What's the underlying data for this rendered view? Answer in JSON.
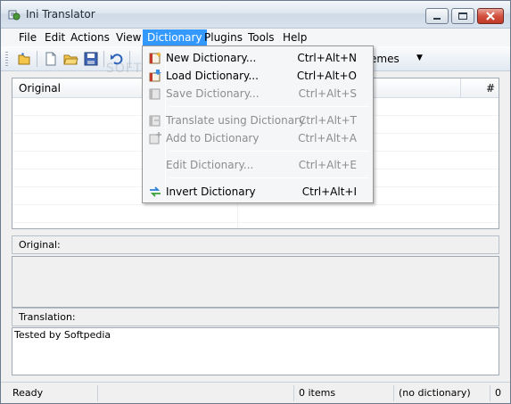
{
  "window": {
    "title": "Ini Translator"
  },
  "menubar": {
    "items": [
      "File",
      "Edit",
      "Actions",
      "View",
      "Dictionary",
      "Plugins",
      "Tools",
      "Help"
    ]
  },
  "toolbar": {
    "themes_label": "emes",
    "themes_arrow": "▼"
  },
  "listview": {
    "columns": [
      "Original",
      "#"
    ]
  },
  "panels": {
    "original_label": "Original:",
    "translation_label": "Translation:",
    "translation_text": "Tested by Softpedia"
  },
  "statusbar": {
    "status": "Ready",
    "items_count": "0 items",
    "dictionary": "(no dictionary)",
    "extra": "0"
  },
  "dictionary_menu": {
    "items": [
      {
        "label": "New Dictionary...",
        "shortcut": "Ctrl+Alt+N",
        "enabled": true,
        "icon": "new-dictionary-icon"
      },
      {
        "label": "Load Dictionary...",
        "shortcut": "Ctrl+Alt+O",
        "enabled": true,
        "icon": "load-dictionary-icon"
      },
      {
        "label": "Save Dictionary...",
        "shortcut": "Ctrl+Alt+S",
        "enabled": false,
        "icon": "save-dictionary-icon"
      },
      {
        "label": "Translate using Dictionary",
        "shortcut": "Ctrl+Alt+T",
        "enabled": false,
        "icon": "translate-dictionary-icon"
      },
      {
        "label": "Add to Dictionary",
        "shortcut": "Ctrl+Alt+A",
        "enabled": false,
        "icon": "add-to-dictionary-icon"
      },
      {
        "label": "Edit Dictionary...",
        "shortcut": "Ctrl+Alt+E",
        "enabled": false,
        "icon": ""
      },
      {
        "label": "Invert Dictionary",
        "shortcut": "Ctrl+Alt+I",
        "enabled": true,
        "icon": "invert-dictionary-icon"
      }
    ]
  },
  "watermark": "SOFTPEDIA",
  "colors": {
    "menu_highlight": "#3399ff",
    "disabled_text": "#8d8d8d",
    "close_button": "#c03a26"
  }
}
